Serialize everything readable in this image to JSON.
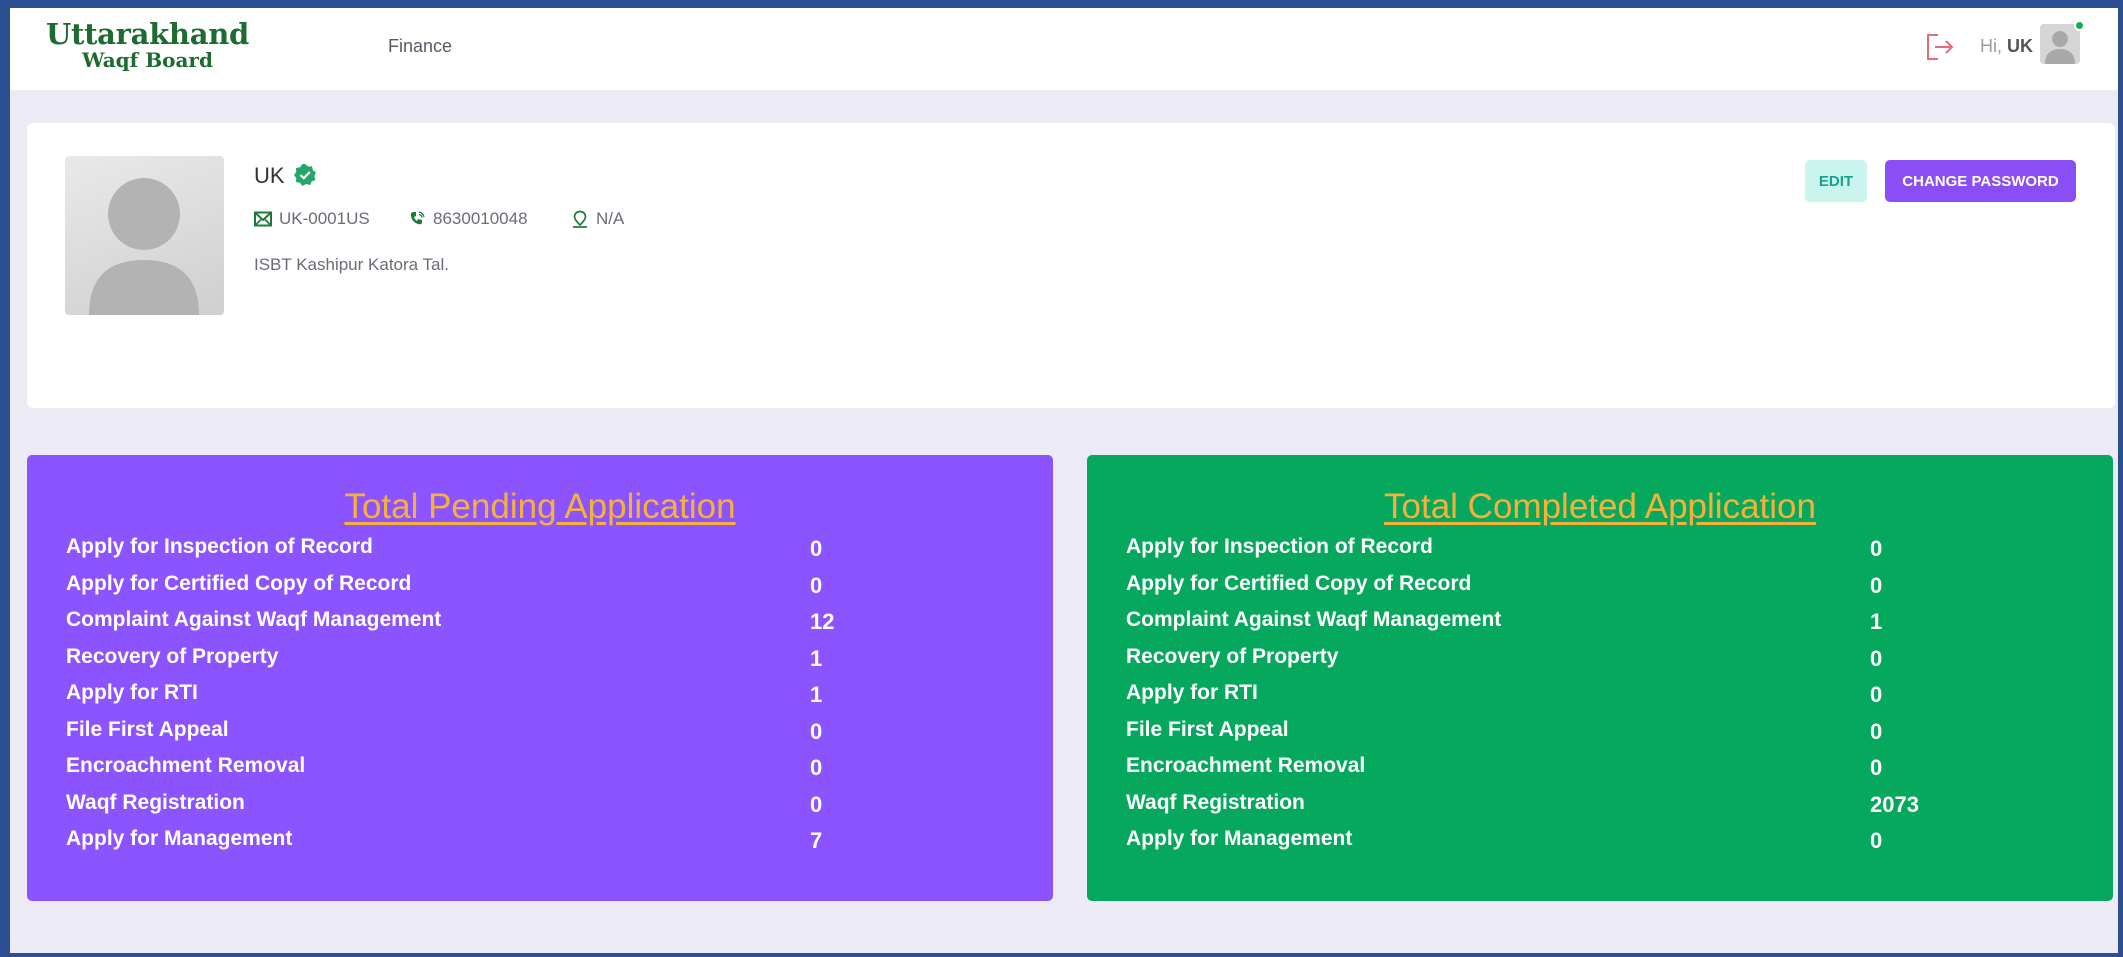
{
  "header": {
    "logo_line1": "Uttarakhand",
    "logo_line2": "Waqf Board",
    "nav_finance": "Finance",
    "greeting_prefix": "Hi,",
    "greeting_user": "UK",
    "logout_icon": "logout-icon",
    "online_color": "#1ea84f"
  },
  "profile": {
    "name": "UK",
    "user_id": "UK-0001US",
    "phone": "8630010048",
    "location": "N/A",
    "address": "ISBT Kashipur Katora Tal.",
    "edit_label": "EDIT",
    "change_password_label": "CHANGE PASSWORD"
  },
  "colors": {
    "accent_purple": "#8c54ff",
    "accent_green": "#06a85e",
    "title_orange": "#f5b13b"
  },
  "pending": {
    "title": "Total Pending Application",
    "rows": [
      {
        "label": "Apply for Inspection of Record",
        "value": "0"
      },
      {
        "label": "Apply for Certified Copy of Record",
        "value": "0"
      },
      {
        "label": "Complaint Against Waqf Management",
        "value": "12"
      },
      {
        "label": "Recovery of Property",
        "value": "1"
      },
      {
        "label": "Apply for RTI",
        "value": "1"
      },
      {
        "label": "File First Appeal",
        "value": "0"
      },
      {
        "label": "Encroachment Removal",
        "value": "0"
      },
      {
        "label": "Waqf Registration",
        "value": "0"
      },
      {
        "label": "Apply for Management",
        "value": "7"
      }
    ]
  },
  "completed": {
    "title": "Total Completed Application",
    "rows": [
      {
        "label": "Apply for Inspection of Record",
        "value": "0"
      },
      {
        "label": "Apply for Certified Copy of Record",
        "value": "0"
      },
      {
        "label": "Complaint Against Waqf Management",
        "value": "1"
      },
      {
        "label": "Recovery of Property",
        "value": "0"
      },
      {
        "label": "Apply for RTI",
        "value": "0"
      },
      {
        "label": "File First Appeal",
        "value": "0"
      },
      {
        "label": "Encroachment Removal",
        "value": "0"
      },
      {
        "label": "Waqf Registration",
        "value": "2073"
      },
      {
        "label": "Apply for Management",
        "value": "0"
      }
    ]
  }
}
